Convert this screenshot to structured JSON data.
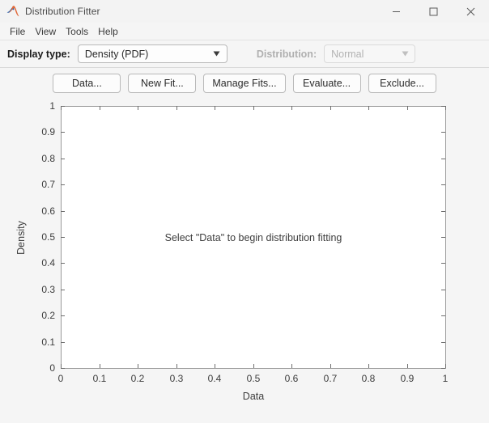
{
  "window": {
    "title": "Distribution Fitter",
    "app_icon": "matlab-membrane-icon",
    "controls": {
      "minimize": "minimize-icon",
      "maximize": "maximize-icon",
      "close": "close-icon"
    }
  },
  "menubar": {
    "items": [
      {
        "label": "File"
      },
      {
        "label": "View"
      },
      {
        "label": "Tools"
      },
      {
        "label": "Help"
      }
    ]
  },
  "toolbar": {
    "display_type_label": "Display type:",
    "display_type_value": "Density (PDF)",
    "distribution_label": "Distribution:",
    "distribution_value": "Normal",
    "distribution_enabled": false,
    "dropdown_icon": "chevron-down-icon"
  },
  "actions": {
    "buttons": [
      {
        "label": "Data...",
        "name": "data-button"
      },
      {
        "label": "New Fit...",
        "name": "new-fit-button"
      },
      {
        "label": "Manage Fits...",
        "name": "manage-fits-button"
      },
      {
        "label": "Evaluate...",
        "name": "evaluate-button"
      },
      {
        "label": "Exclude...",
        "name": "exclude-button"
      }
    ]
  },
  "plot": {
    "empty_message": "Select \"Data\" to begin distribution fitting"
  },
  "chart_data": {
    "type": "line",
    "title": "",
    "xlabel": "Data",
    "ylabel": "Density",
    "xlim": [
      0,
      1
    ],
    "ylim": [
      0,
      1
    ],
    "xticks": [
      0,
      0.1,
      0.2,
      0.3,
      0.4,
      0.5,
      0.6,
      0.7,
      0.8,
      0.9,
      1
    ],
    "yticks": [
      0,
      0.1,
      0.2,
      0.3,
      0.4,
      0.5,
      0.6,
      0.7,
      0.8,
      0.9,
      1
    ],
    "xticklabels": [
      "0",
      "0.1",
      "0.2",
      "0.3",
      "0.4",
      "0.5",
      "0.6",
      "0.7",
      "0.8",
      "0.9",
      "1"
    ],
    "yticklabels": [
      "0",
      "0.1",
      "0.2",
      "0.3",
      "0.4",
      "0.5",
      "0.6",
      "0.7",
      "0.8",
      "0.9",
      "1"
    ],
    "grid": false,
    "legend": null,
    "series": [],
    "annotations": [
      "Select \"Data\" to begin distribution fitting"
    ]
  },
  "colors": {
    "window_bg": "#f0f0f0",
    "panel_bg": "#f5f5f5",
    "titlebar_bg": "#f3f3f3",
    "axes_bg": "#ffffff",
    "axes_border": "#9a9a9a",
    "text": "#3d3d3d",
    "disabled_text": "#b2b2b2",
    "matlab_orange": "#e16737",
    "matlab_blue": "#2b5fa8"
  }
}
